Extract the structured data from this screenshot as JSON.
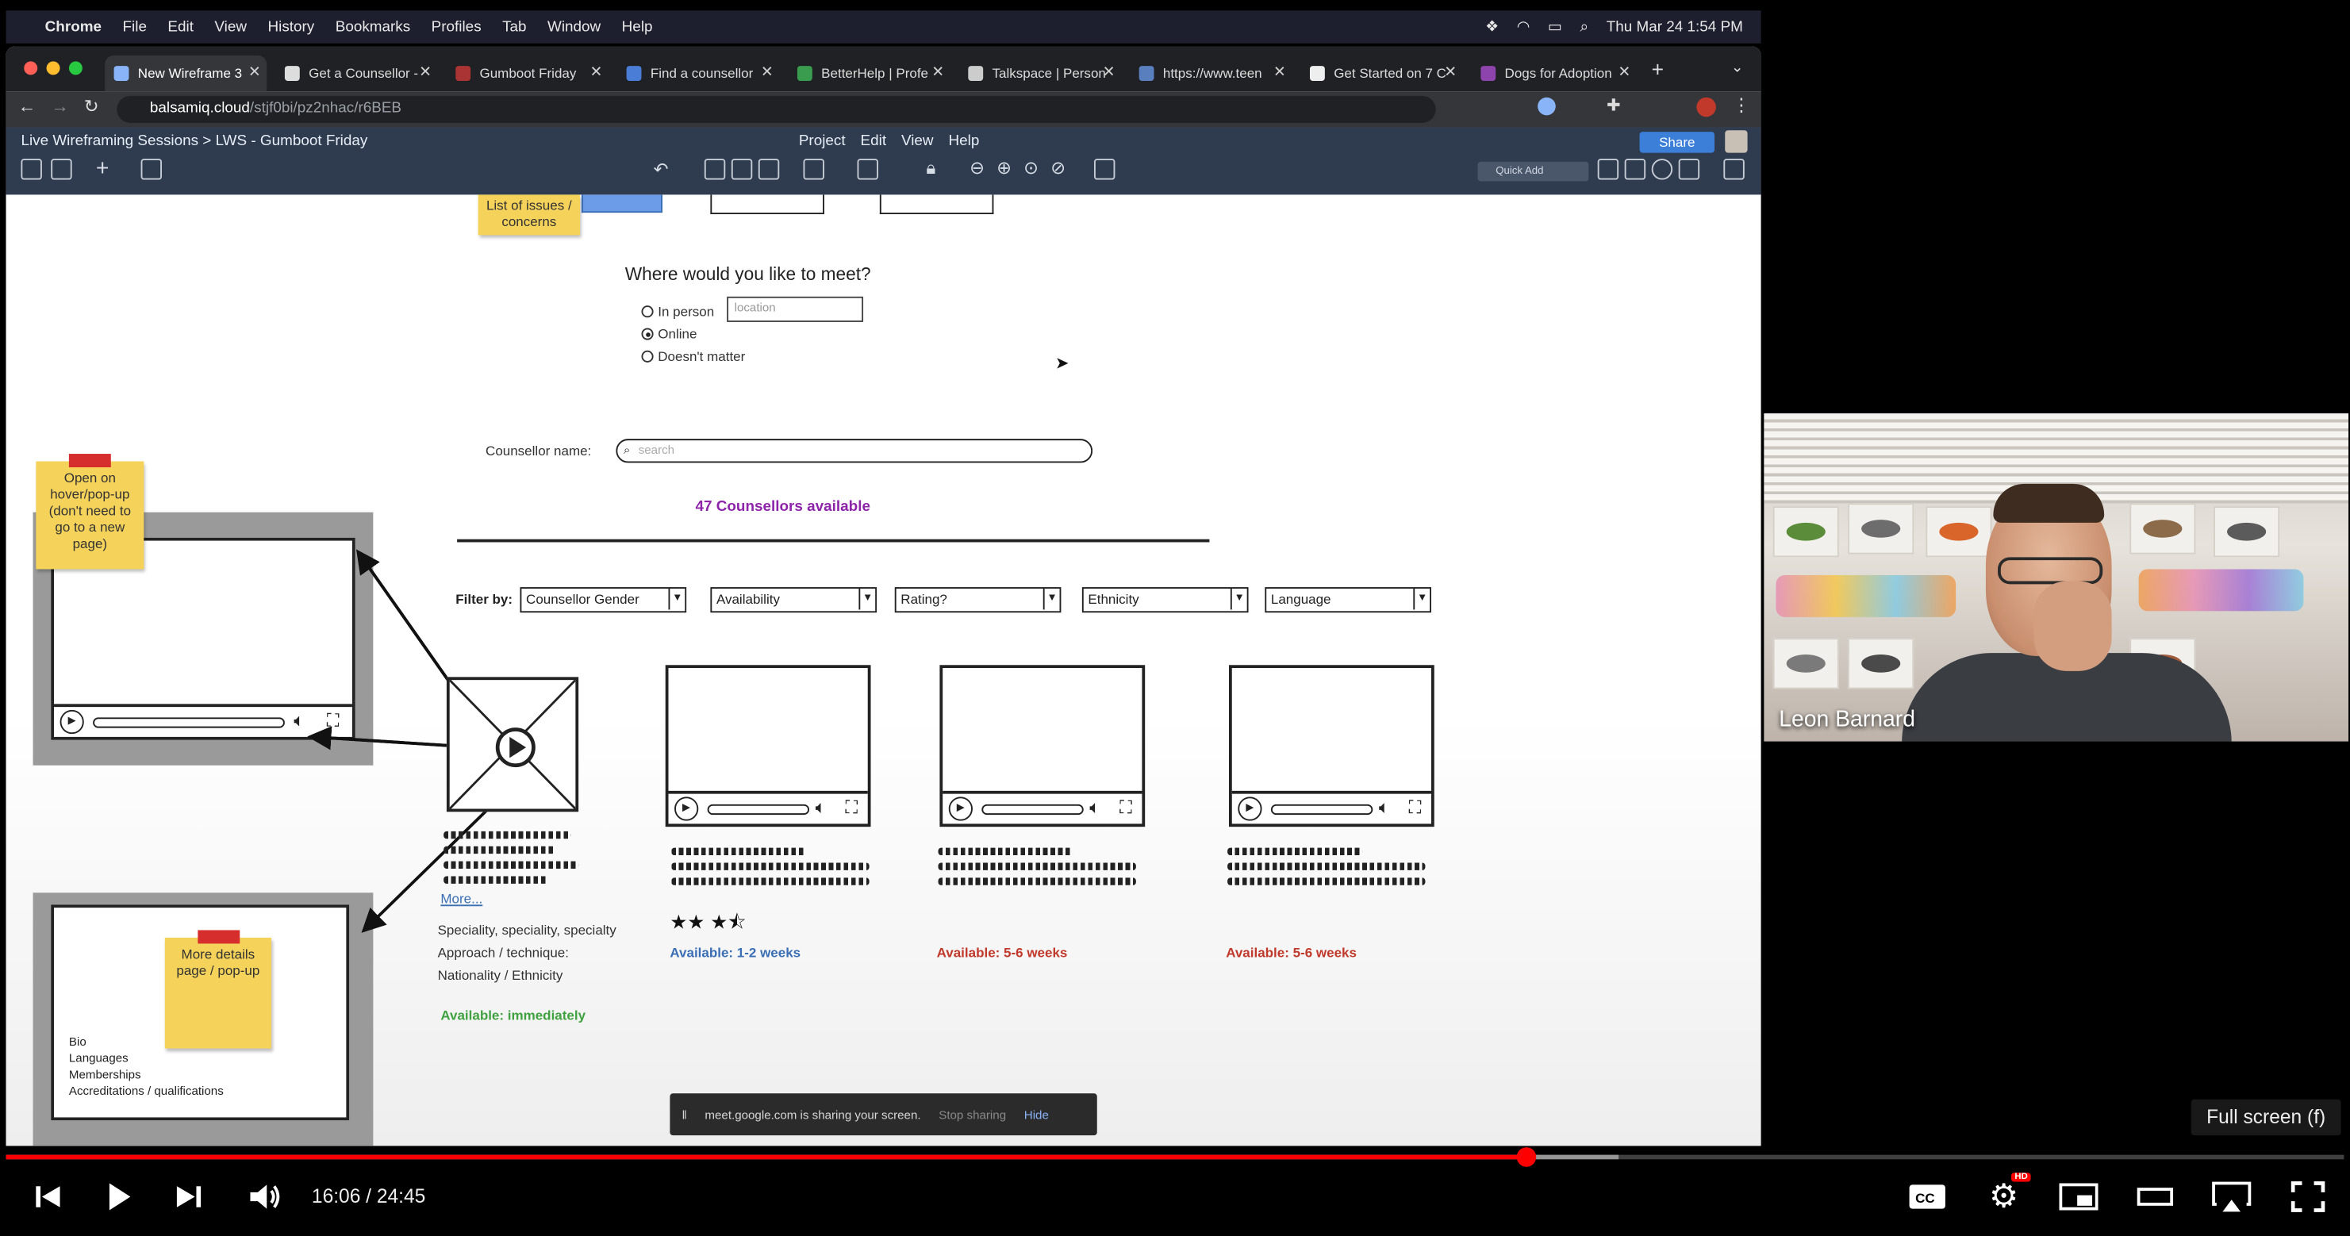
{
  "macos_menubar": {
    "app": "Chrome",
    "items": [
      "File",
      "Edit",
      "View",
      "History",
      "Bookmarks",
      "Profiles",
      "Tab",
      "Window",
      "Help"
    ],
    "clock": "Thu Mar 24  1:54 PM"
  },
  "browser": {
    "tabs": [
      {
        "title": "New Wireframe 3",
        "active": true
      },
      {
        "title": "Get a Counsellor -"
      },
      {
        "title": "Gumboot Friday"
      },
      {
        "title": "Find a counsellor"
      },
      {
        "title": "BetterHelp | Profe"
      },
      {
        "title": "Talkspace | Person"
      },
      {
        "title": "https://www.teen"
      },
      {
        "title": "Get Started on 7 C"
      },
      {
        "title": "Dogs for Adoption"
      }
    ],
    "url_host": "balsamiq.cloud",
    "url_path": "/stjf0bi/pz2nhac/r6BEB"
  },
  "balsamiq": {
    "breadcrumb": "Live Wireframing Sessions  >  LWS - Gumboot Friday",
    "menu": [
      "Project",
      "Edit",
      "View",
      "Help"
    ],
    "share_label": "Share",
    "quick_add_placeholder": "Quick Add"
  },
  "wireframe": {
    "sticky_top": "List of issues / concerns",
    "meet_question": "Where would you like to meet?",
    "meet_options": [
      "In person",
      "Online",
      "Doesn't matter"
    ],
    "meet_selected": "Online",
    "location_placeholder": "location",
    "counsellor_name_label": "Counsellor name:",
    "search_placeholder": "search",
    "available_count": "47 Counsellors available",
    "filter_label": "Filter by:",
    "filters": [
      "Counsellor Gender",
      "Availability",
      "Rating?",
      "Ethnicity",
      "Language"
    ],
    "sticky_popup": "Open on hover/pop-up (don't need to go to a new page)",
    "sticky_details": "More details page / pop-up",
    "details_list": [
      "Bio",
      "Languages",
      "Memberships",
      "Accreditations / qualifications"
    ],
    "more_link": "More...",
    "specialities": [
      "Speciality, speciality, specialty",
      "Approach / technique:",
      "Nationality / Ethnicity"
    ],
    "availability": [
      {
        "text": "Available: immediately",
        "color": "#3fa13f"
      },
      {
        "text": "Available: 1-2 weeks",
        "color": "#3a6fb5"
      },
      {
        "text": "Available: 5-6 weeks",
        "color": "#c0392b"
      },
      {
        "text": "Available: 5-6 weeks",
        "color": "#c0392b"
      }
    ],
    "rating_stars": "★★ ★⯪"
  },
  "screen_share_bar": {
    "message": "meet.google.com is sharing your screen.",
    "stop_label": "Stop sharing",
    "hide_label": "Hide"
  },
  "webcam": {
    "speaker": "Leon Barnard"
  },
  "player": {
    "time_current": "16:06",
    "time_total": "24:45",
    "time_display": "16:06 / 24:45",
    "played_fraction": 0.65,
    "buffered_fraction": 0.69,
    "tooltip": "Full screen (f)",
    "accent": "#ff0000"
  }
}
